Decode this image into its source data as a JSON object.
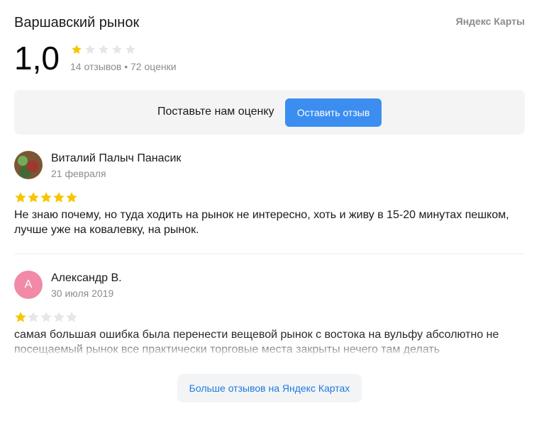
{
  "place": {
    "name": "Варшавский рынок",
    "brand": "Яндекс Карты"
  },
  "rating": {
    "value": "1,0",
    "stars": 1,
    "max_stars": 5,
    "stats": "14 отзывов • 72 оценки"
  },
  "cta": {
    "text": "Поставьте нам оценку",
    "button_label": "Оставить отзыв"
  },
  "reviews": [
    {
      "author": "Виталий Палыч Панасик",
      "date": "21 февраля",
      "stars": 5,
      "text": "Не знаю почему, но туда ходить на рынок не интересно, хоть и живу в 15-20 минутах пешком, лучше уже на ковалевку, на рынок.",
      "avatar_initial": ""
    },
    {
      "author": "Александр В.",
      "date": "30 июля 2019",
      "stars": 1,
      "text": "самая большая ошибка была перенести вещевой рынок с востока на вульфу абсолютно не посещаемый рынок все практически торговые места закрыты нечего там делать",
      "avatar_initial": "А"
    }
  ],
  "more_button": {
    "label": "Больше отзывов на Яндекс Картах"
  },
  "colors": {
    "star_filled": "#f6c600",
    "star_empty": "#e6e6e6",
    "accent": "#3c8df0",
    "link": "#1e7be0",
    "avatar_letter_bg": "#f08aa7"
  }
}
